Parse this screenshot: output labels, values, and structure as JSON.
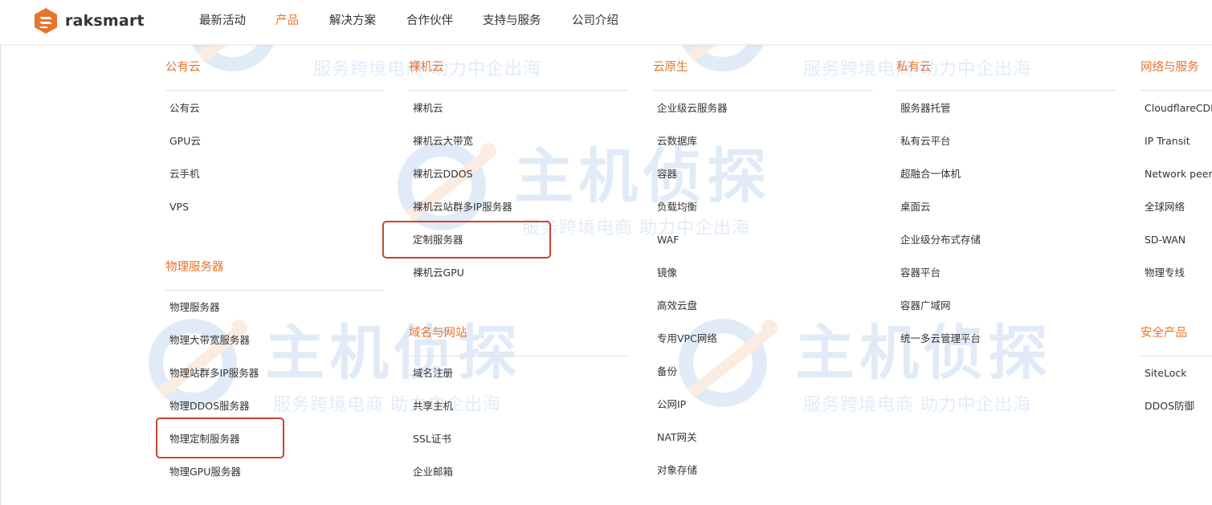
{
  "brand": {
    "name": "raksmart",
    "accent_color": "#e8742c",
    "highlight_color": "#d0432d"
  },
  "nav": {
    "items": [
      {
        "label": "最新活动",
        "active": false
      },
      {
        "label": "产品",
        "active": true
      },
      {
        "label": "解决方案",
        "active": false
      },
      {
        "label": "合作伙伴",
        "active": false
      },
      {
        "label": "支持与服务",
        "active": false
      },
      {
        "label": "公司介绍",
        "active": false
      }
    ]
  },
  "menu": {
    "public_cloud": {
      "title": "公有云",
      "items": [
        "公有云",
        "GPU云",
        "云手机",
        "VPS"
      ]
    },
    "physical_servers": {
      "title": "物理服务器",
      "items": [
        "物理服务器",
        "物理大带宽服务器",
        "物理站群多IP服务器",
        "物理DDOS服务器",
        "物理定制服务器",
        "物理GPU服务器"
      ]
    },
    "bare_metal": {
      "title": "裸机云",
      "items": [
        "裸机云",
        "裸机云大带宽",
        "裸机云DDOS",
        "裸机云站群多IP服务器",
        "定制服务器",
        "裸机云GPU"
      ]
    },
    "domains": {
      "title": "域名与网站",
      "items": [
        "域名注册",
        "共享主机",
        "SSL证书",
        "企业邮箱"
      ]
    },
    "cloud_native": {
      "title": "云原生",
      "items": [
        "企业级云服务器",
        "云数据库",
        "容器",
        "负载均衡",
        "WAF",
        "镜像",
        "高效云盘",
        "专用VPC网络",
        "备份",
        "公网IP",
        "NAT网关",
        "对象存储"
      ]
    },
    "private_cloud": {
      "title": "私有云",
      "items": [
        "服务器托管",
        "私有云平台",
        "超融合一体机",
        "桌面云",
        "企业级分布式存储",
        "容器平台",
        "容器广域网",
        "统一多云管理平台"
      ]
    },
    "network": {
      "title": "网络与服务",
      "items": [
        "CloudflareCDN",
        "IP Transit",
        "Network peering",
        "全球网络",
        "SD-WAN",
        "物理专线"
      ]
    },
    "security": {
      "title": "安全产品",
      "items": [
        "SiteLock",
        "DDOS防御"
      ]
    }
  },
  "watermark": {
    "title": "主机侦探",
    "subtitle": "服务跨境电商 助力中企出海"
  }
}
